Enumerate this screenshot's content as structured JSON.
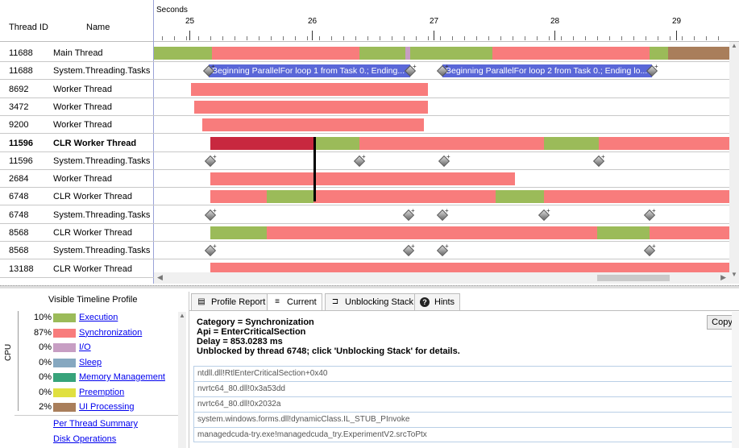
{
  "columns": {
    "thread_id": "Thread ID",
    "name": "Name"
  },
  "ruler": {
    "title": "Seconds",
    "ticks": [
      "25",
      "26",
      "27",
      "28",
      "29"
    ]
  },
  "colors": {
    "execution": "#9bbb59",
    "synchronization": "#f87c7c",
    "io": "#c79ec3",
    "sleep": "#86a8c0",
    "memory_management": "#37a37a",
    "preemption": "#e0e040",
    "ui_processing": "#a97e5b",
    "selected_segment": "#c8283f",
    "marker_band": "#5a67d8"
  },
  "threads": [
    {
      "id": "11688",
      "name": "Main Thread",
      "bold": false
    },
    {
      "id": "11688",
      "name": "System.Threading.Tasks",
      "bold": false
    },
    {
      "id": "8692",
      "name": "Worker Thread",
      "bold": false
    },
    {
      "id": "3472",
      "name": "Worker Thread",
      "bold": false
    },
    {
      "id": "9200",
      "name": "Worker Thread",
      "bold": false
    },
    {
      "id": "11596",
      "name": "CLR Worker Thread",
      "bold": true
    },
    {
      "id": "11596",
      "name": "System.Threading.Tasks",
      "bold": false
    },
    {
      "id": "2684",
      "name": "Worker Thread",
      "bold": false
    },
    {
      "id": "6748",
      "name": "CLR Worker Thread",
      "bold": false
    },
    {
      "id": "6748",
      "name": "System.Threading.Tasks",
      "bold": false
    },
    {
      "id": "8568",
      "name": "CLR Worker Thread",
      "bold": false
    },
    {
      "id": "8568",
      "name": "System.Threading.Tasks",
      "bold": false
    },
    {
      "id": "13188",
      "name": "CLR Worker Thread",
      "bold": false
    }
  ],
  "markers": {
    "band1": "Beginning ParallelFor loop 1 from Task 0.; Ending...",
    "band2": "Beginning ParallelFor loop 2 from Task 0.; Ending lo..."
  },
  "legend": {
    "title": "Visible Timeline Profile",
    "cpu_label": "CPU",
    "items": [
      {
        "pct": "10%",
        "label": "Execution",
        "color": "#9bbb59"
      },
      {
        "pct": "87%",
        "label": "Synchronization",
        "color": "#f87c7c"
      },
      {
        "pct": "0%",
        "label": "I/O",
        "color": "#c79ec3"
      },
      {
        "pct": "0%",
        "label": "Sleep",
        "color": "#86a8c0"
      },
      {
        "pct": "0%",
        "label": "Memory Management",
        "color": "#37a37a"
      },
      {
        "pct": "0%",
        "label": "Preemption",
        "color": "#e0e040"
      },
      {
        "pct": "2%",
        "label": "UI Processing",
        "color": "#a97e5b"
      }
    ],
    "links": [
      "Per Thread Summary",
      "Disk Operations"
    ]
  },
  "tabs": [
    {
      "label": "Profile Report",
      "icon": "report-icon",
      "active": false
    },
    {
      "label": "Current",
      "icon": "current-icon",
      "active": true
    },
    {
      "label": "Unblocking Stack",
      "icon": "stack-icon",
      "active": false
    },
    {
      "label": "Hints",
      "icon": "help-icon",
      "active": false
    }
  ],
  "details": {
    "lines": [
      "Category = Synchronization",
      "Api = EnterCriticalSection",
      "Delay = 853.0283 ms",
      "Unblocked by thread 6748; click 'Unblocking Stack' for details."
    ],
    "copy_label": "Copy",
    "stack": [
      "ntdll.dll!RtlEnterCriticalSection+0x40",
      "nvrtc64_80.dll!0x3a53dd",
      "nvrtc64_80.dll!0x2032a",
      "system.windows.forms.dll!dynamicClass.IL_STUB_PInvoke",
      "managedcuda-try.exe!managedcuda_try.ExperimentV2.srcToPtx"
    ]
  }
}
